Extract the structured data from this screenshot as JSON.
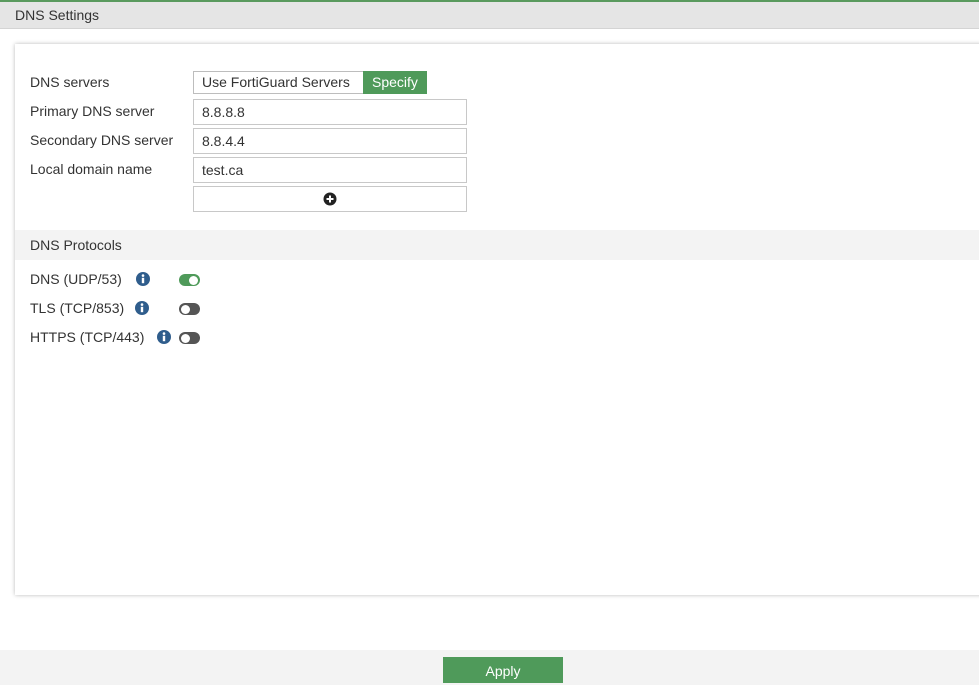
{
  "header": {
    "title": "DNS Settings"
  },
  "dns_servers": {
    "label": "DNS servers",
    "options": [
      "Use FortiGuard Servers",
      "Specify"
    ],
    "selected": "Specify"
  },
  "primary": {
    "label": "Primary DNS server",
    "value": "8.8.8.8"
  },
  "secondary": {
    "label": "Secondary DNS server",
    "value": "8.8.4.4"
  },
  "local_domain": {
    "label": "Local domain name",
    "value": "test.ca"
  },
  "add_button": {
    "icon": "plus-circle-icon"
  },
  "protocols": {
    "title": "DNS Protocols",
    "items": [
      {
        "label": "DNS (UDP/53)",
        "enabled": true
      },
      {
        "label": "TLS (TCP/853)",
        "enabled": false
      },
      {
        "label": "HTTPS (TCP/443)",
        "enabled": false
      }
    ]
  },
  "footer": {
    "apply_label": "Apply"
  },
  "colors": {
    "accent": "#4f9a5a",
    "toggle_off": "#555555",
    "info_icon": "#2f5d8c"
  }
}
